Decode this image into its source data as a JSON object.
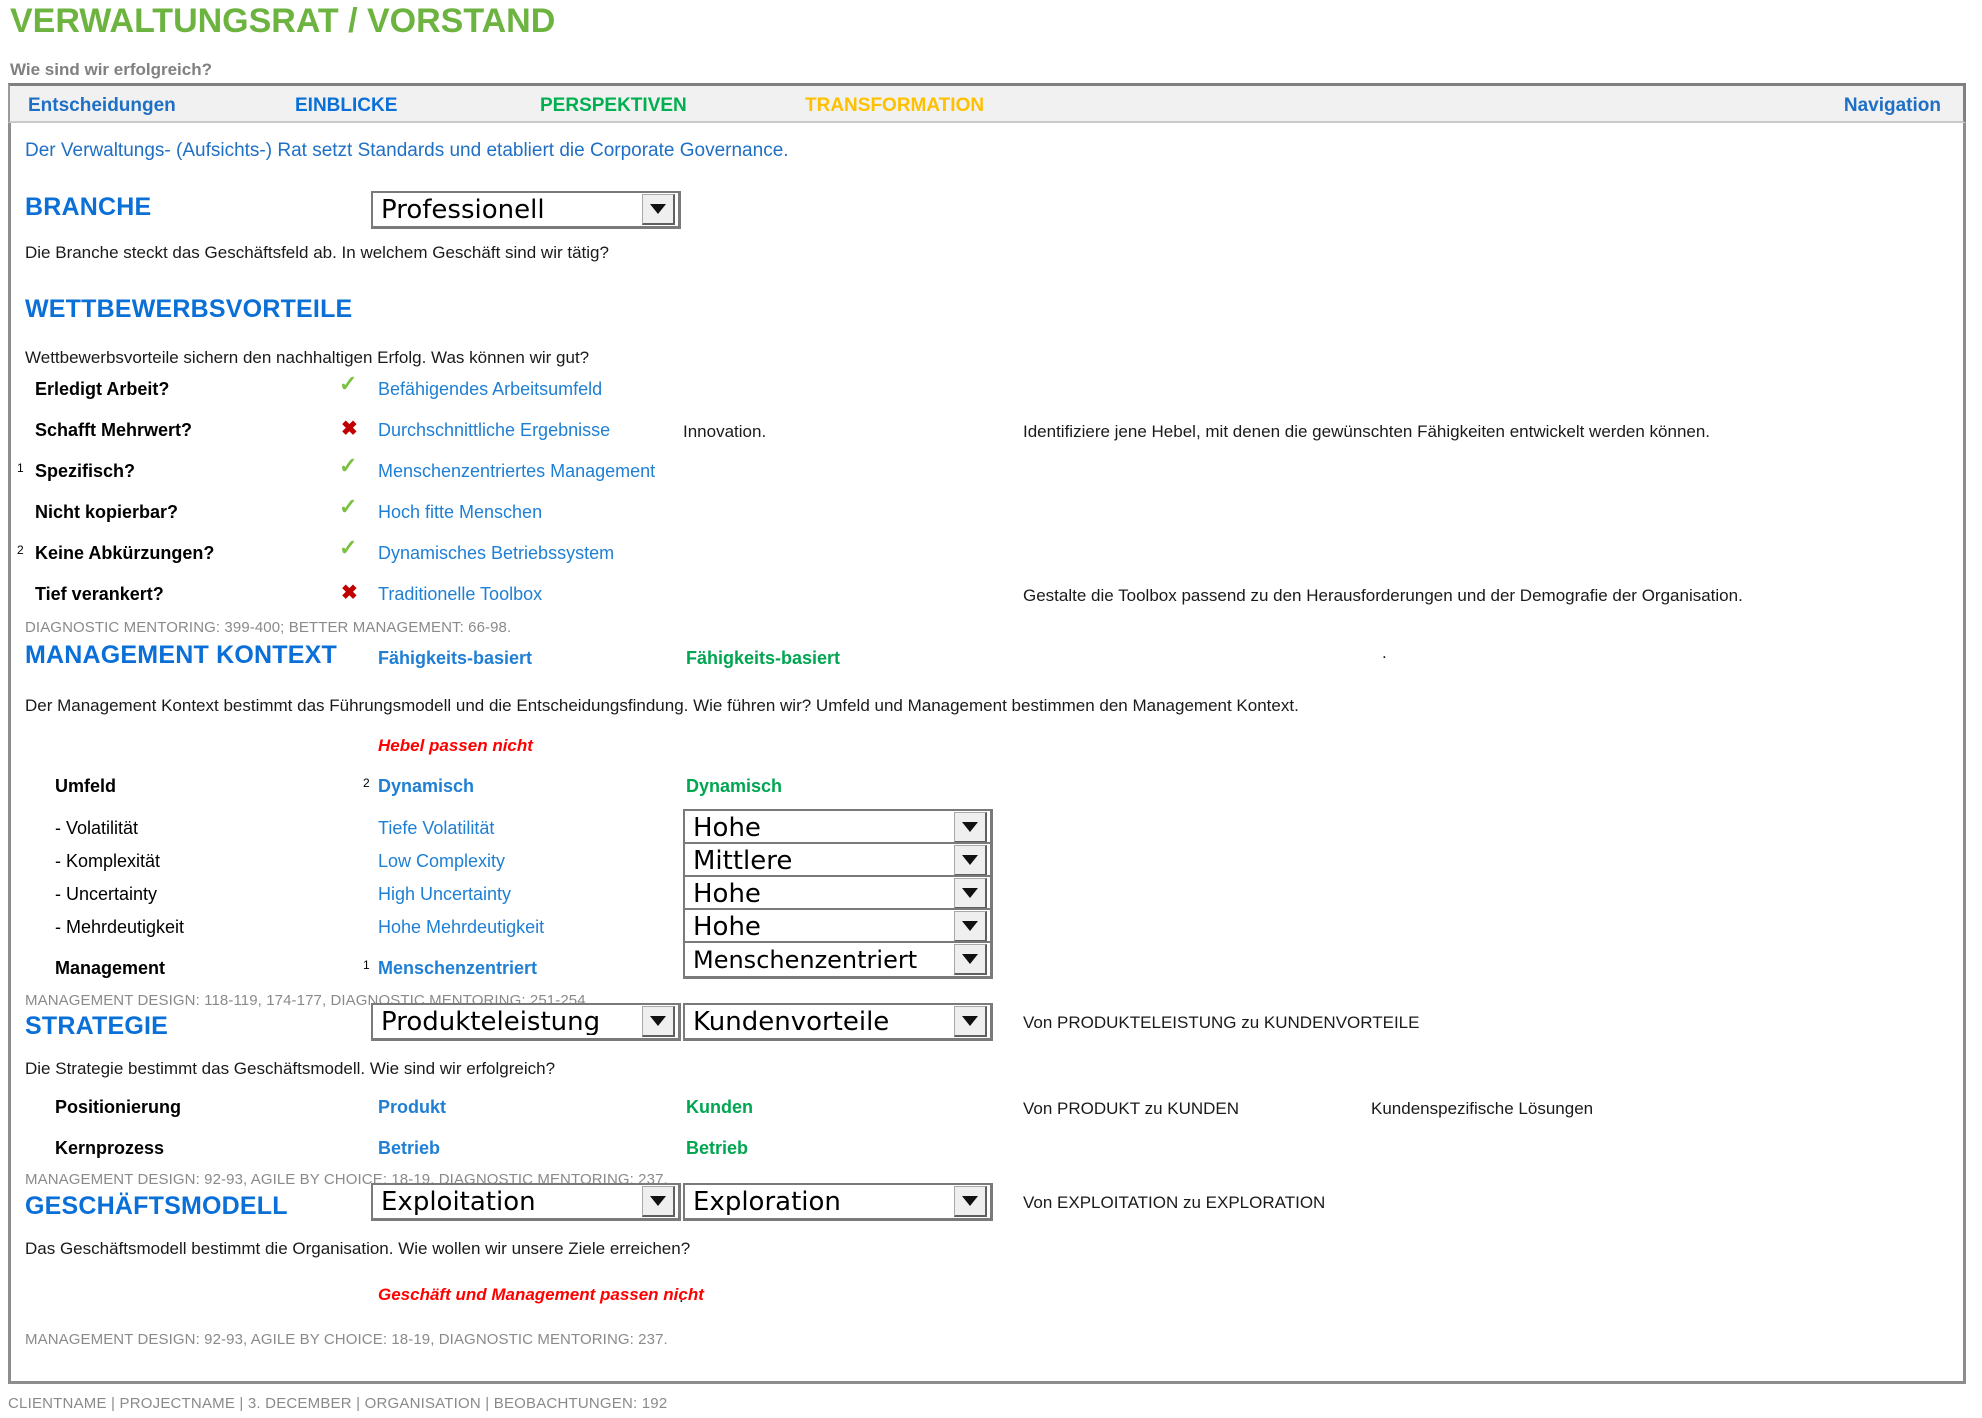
{
  "header": {
    "title": "VERWALTUNGSRAT / VORSTAND",
    "subtitle": "Wie sind wir erfolgreich?",
    "title_color": "#6CB33F"
  },
  "navbar": {
    "items": [
      {
        "label": "Entscheidungen",
        "color": "#1F6FC4"
      },
      {
        "label": "EINBLICKE",
        "color": "#0A6FD6"
      },
      {
        "label": "PERSPEKTIVEN",
        "color": "#00B050"
      },
      {
        "label": "TRANSFORMATION",
        "color": "#FFC000"
      },
      {
        "label": "Navigation",
        "color": "#1F6FC4"
      }
    ]
  },
  "intro": "Der Verwaltungs- (Aufsichts-) Rat setzt Standards und etabliert die Corporate Governance.",
  "branche": {
    "heading": "BRANCHE",
    "select_value": "Professionell",
    "description": "Die Branche steckt das Geschäftsfeld ab. In welchem Geschäft sind wir tätig?"
  },
  "wettbewerbsvorteile": {
    "heading": "WETTBEWERBSVORTEILE",
    "description": "Wettbewerbsvorteile sichern den nachhaltigen Erfolg. Was können wir gut?",
    "rows": [
      {
        "sup": "",
        "label": "Erledigt Arbeit?",
        "mark": "check",
        "value": "Befähigendes Arbeitsumfeld",
        "mid": "",
        "comment": ""
      },
      {
        "sup": "",
        "label": "Schafft Mehrwert?",
        "mark": "cross",
        "value": "Durchschnittliche Ergebnisse",
        "mid": "Innovation.",
        "comment": "Identifiziere jene Hebel, mit denen die gewünschten Fähigkeiten entwickelt werden können."
      },
      {
        "sup": "1",
        "label": "Spezifisch?",
        "mark": "check",
        "value": "Menschenzentriertes Management",
        "mid": "",
        "comment": ""
      },
      {
        "sup": "",
        "label": "Nicht kopierbar?",
        "mark": "check",
        "value": "Hoch fitte Menschen",
        "mid": "",
        "comment": ""
      },
      {
        "sup": "2",
        "label": "Keine Abkürzungen?",
        "mark": "check",
        "value": "Dynamisches Betriebssystem",
        "mid": "",
        "comment": ""
      },
      {
        "sup": "",
        "label": "Tief verankert?",
        "mark": "cross",
        "value": "Traditionelle Toolbox",
        "mid": "",
        "comment": "Gestalte die Toolbox passend zu den Herausforderungen und der Demografie der Organisation."
      }
    ],
    "source_note": "DIAGNOSTIC MENTORING: 399-400; BETTER MANAGEMENT: 66-98."
  },
  "management_kontext": {
    "heading": "MANAGEMENT KONTEXT",
    "col_insight": "Fähigkeits-basiert",
    "col_perspective": "Fähigkeits-basiert",
    "trailing_dot": ".",
    "description": "Der Management Kontext bestimmt das Führungsmodell und die Entscheidungsfindung. Wie führen wir? Umfeld und Management bestimmen den Management Kontext.",
    "warning": "Hebel passen nicht",
    "rows": [
      {
        "sup": "2",
        "label": "Umfeld",
        "bold": true,
        "insight": "Dynamisch",
        "perspective": "Dynamisch",
        "select_value": ""
      },
      {
        "sup": "",
        "label": "- Volatilität",
        "bold": false,
        "insight": "Tiefe Volatilität",
        "perspective": "",
        "select_value": "Hohe"
      },
      {
        "sup": "",
        "label": "- Komplexität",
        "bold": false,
        "insight": "Low Complexity",
        "perspective": "",
        "select_value": "Mittlere"
      },
      {
        "sup": "",
        "label": "- Uncertainty",
        "bold": false,
        "insight": "High Uncertainty",
        "perspective": "",
        "select_value": "Hohe"
      },
      {
        "sup": "",
        "label": "- Mehrdeutigkeit",
        "bold": false,
        "insight": "Hohe Mehrdeutigkeit",
        "perspective": "",
        "select_value": "Hohe"
      },
      {
        "sup": "1",
        "label": "Management",
        "bold": true,
        "insight": "Menschenzentriert",
        "perspective": "",
        "select_value": "Menschenzentriert"
      }
    ],
    "source_note": "MANAGEMENT DESIGN: 118-119, 174-177, DIAGNOSTIC MENTORING: 251-254"
  },
  "strategie": {
    "heading": "STRATEGIE",
    "select_left": "Produkteleistung",
    "select_right": "Kundenvorteile",
    "transformation": "Von PRODUKTELEISTUNG zu KUNDENVORTEILE",
    "description": "Die Strategie bestimmt das Geschäftsmodell. Wie sind wir erfolgreich?",
    "rows": [
      {
        "label": "Positionierung",
        "insight": "Produkt",
        "perspective": "Kunden",
        "transformation": "Von PRODUKT zu KUNDEN",
        "extra": "Kundenspezifische Lösungen"
      },
      {
        "label": "Kernprozess",
        "insight": "Betrieb",
        "perspective": "Betrieb",
        "transformation": "",
        "extra": ""
      }
    ],
    "source_note": "MANAGEMENT DESIGN: 92-93, AGILE BY CHOICE: 18-19, DIAGNOSTIC MENTORING: 237."
  },
  "geschaeftsmodell": {
    "heading": "GESCHÄFTSMODELL",
    "select_left": "Exploitation",
    "select_right": "Exploration",
    "transformation": "Von EXPLOITATION zu EXPLORATION",
    "description": "Das Geschäftsmodell bestimmt die Organisation. Wie wollen wir unsere Ziele erreichen?",
    "warning": "Geschäft und Management passen nicht",
    "warning_dot": ".",
    "source_note": "MANAGEMENT DESIGN: 92-93, AGILE BY CHOICE: 18-19, DIAGNOSTIC MENTORING: 237."
  },
  "icons": {
    "check": "✓",
    "cross": "✖",
    "caret_down": "chevron-down-icon"
  },
  "footer": "CLIENTNAME | PROJECTNAME | 3. DECEMBER | ORGANISATION | BEOBACHTUNGEN: 192"
}
